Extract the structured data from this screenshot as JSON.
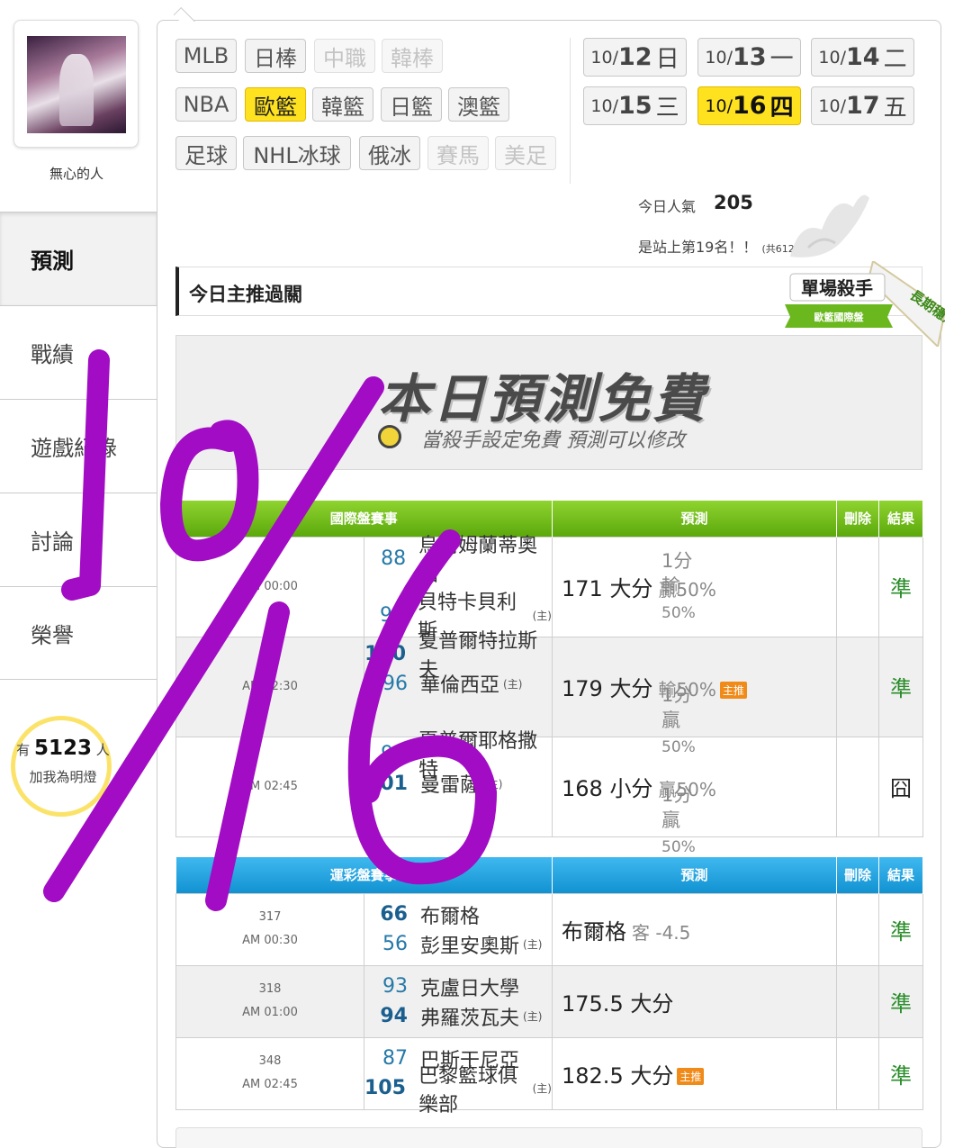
{
  "sidebar": {
    "username": "無心的人",
    "nav": [
      {
        "label": "預測",
        "active": true
      },
      {
        "label": "戰績",
        "active": false
      },
      {
        "label": "遊戲紀錄",
        "active": false
      },
      {
        "label": "討論",
        "active": false
      },
      {
        "label": "榮譽",
        "active": false
      }
    ],
    "fans": {
      "prefix": "有",
      "count": "5123",
      "suffix": "人",
      "cta": "加我為明燈"
    }
  },
  "leagues": [
    {
      "label": "MLB",
      "state": "normal"
    },
    {
      "label": "日棒",
      "state": "normal"
    },
    {
      "label": "中職",
      "state": "disabled"
    },
    {
      "label": "韓棒",
      "state": "disabled"
    },
    {
      "label": "NBA",
      "state": "normal"
    },
    {
      "label": "歐籃",
      "state": "active"
    },
    {
      "label": "韓籃",
      "state": "normal"
    },
    {
      "label": "日籃",
      "state": "normal"
    },
    {
      "label": "澳籃",
      "state": "normal"
    },
    {
      "label": "足球",
      "state": "normal"
    },
    {
      "label": "NHL冰球",
      "state": "normal"
    },
    {
      "label": "俄冰",
      "state": "normal"
    },
    {
      "label": "賽馬",
      "state": "disabled"
    },
    {
      "label": "美足",
      "state": "disabled"
    }
  ],
  "dates": [
    {
      "month": "10/",
      "day": "12",
      "weekday": "日",
      "active": false
    },
    {
      "month": "10/",
      "day": "13",
      "weekday": "一",
      "active": false
    },
    {
      "month": "10/",
      "day": "14",
      "weekday": "二",
      "active": false
    },
    {
      "month": "10/",
      "day": "15",
      "weekday": "三",
      "active": false
    },
    {
      "month": "10/",
      "day": "16",
      "weekday": "四",
      "active": true
    },
    {
      "month": "10/",
      "day": "17",
      "weekday": "五",
      "active": false
    }
  ],
  "popularity": {
    "label": "今日人氣",
    "value": "205",
    "rank_text": "是站上第19名！！",
    "rank_total": "(共6122人)"
  },
  "section_title": "今日主推過關",
  "badge": {
    "title": "單場殺手",
    "subtitle": "歐籃國際盤",
    "ribbon": "長期穩定"
  },
  "free_banner": {
    "title": "本日預測免費",
    "subtitle": "當殺手設定免費 預測可以修改"
  },
  "intl_table": {
    "headers": {
      "match": "國際盤賽事",
      "prediction": "預測",
      "delete": "刪除",
      "result": "結果"
    },
    "rows": [
      {
        "code": "",
        "time": "AM 00:00",
        "teams": [
          {
            "score": "88",
            "name": "烏爾姆蘭蒂奧帕",
            "home": ""
          },
          {
            "score": "94",
            "name": "貝特卡貝利斯",
            "home": "(主)"
          }
        ],
        "line": "1分輸",
        "line_pct": "50%",
        "prediction": "171 大分",
        "pred_note": "贏50%",
        "star": "",
        "result": "準"
      },
      {
        "code": "",
        "time": "AM 02:30",
        "teams": [
          {
            "score": "100",
            "name": "夏普爾特拉斯夫",
            "home": ""
          },
          {
            "score": "96",
            "name": "華倫西亞",
            "home": "(主)"
          }
        ],
        "line": "1分贏",
        "line_pct": "50%",
        "prediction": "179 大分",
        "pred_note": "輸50%",
        "star": "主推",
        "result": "準"
      },
      {
        "code": "",
        "time": "AM 02:45",
        "teams": [
          {
            "score": "94",
            "name": "夏普爾耶格撒特",
            "home": ""
          },
          {
            "score": "101",
            "name": "曼雷薩",
            "home": "(主)"
          }
        ],
        "line": "1分贏",
        "line_pct": "50%",
        "prediction": "168 小分",
        "pred_note": "贏50%",
        "star": "",
        "result": "囧"
      }
    ]
  },
  "lottery_table": {
    "headers": {
      "match": "運彩盤賽事",
      "prediction": "預測",
      "delete": "刪除",
      "result": "結果"
    },
    "rows": [
      {
        "code": "317",
        "time": "AM 00:30",
        "teams": [
          {
            "score": "66",
            "name": "布爾格",
            "home": "",
            "hi": true
          },
          {
            "score": "56",
            "name": "彭里安奧斯",
            "home": "(主)",
            "hi": false
          }
        ],
        "prediction": "布爾格",
        "pred_note": "客 -4.5",
        "star": "",
        "result": "準"
      },
      {
        "code": "318",
        "time": "AM 01:00",
        "teams": [
          {
            "score": "93",
            "name": "克盧日大學",
            "home": "",
            "hi": false
          },
          {
            "score": "94",
            "name": "弗羅茨瓦夫",
            "home": "(主)",
            "hi": true
          }
        ],
        "prediction": "175.5 大分",
        "pred_note": "",
        "star": "",
        "result": "準"
      },
      {
        "code": "348",
        "time": "AM 02:45",
        "teams": [
          {
            "score": "87",
            "name": "巴斯干尼亞",
            "home": "",
            "hi": false
          },
          {
            "score": "105",
            "name": "巴黎籃球俱樂部",
            "home": "(主)",
            "hi": true
          }
        ],
        "prediction": "182.5 大分",
        "pred_note": "",
        "star": "主推",
        "result": "準"
      }
    ]
  },
  "colors": {
    "active_yellow": "#ffe21f",
    "intl_header_green": "#6bb818",
    "lottery_header_blue": "#1ea2df",
    "win_green": "#2a8d2a",
    "scrawl_purple": "#a10cc4"
  }
}
